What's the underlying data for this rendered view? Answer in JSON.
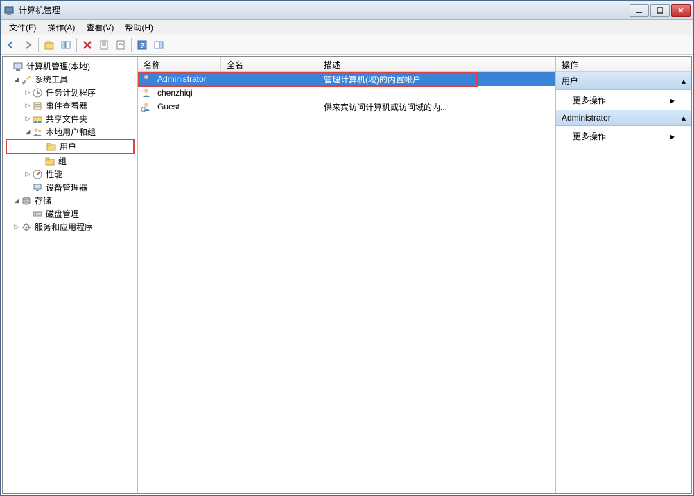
{
  "window": {
    "title": "计算机管理"
  },
  "menu": {
    "file": "文件(F)",
    "action": "操作(A)",
    "view": "查看(V)",
    "help": "帮助(H)"
  },
  "tree": {
    "root": "计算机管理(本地)",
    "systools": "系统工具",
    "task_sched": "任务计划程序",
    "event_viewer": "事件查看器",
    "shared_folders": "共享文件夹",
    "local_users": "本地用户和组",
    "users": "用户",
    "groups": "组",
    "performance": "性能",
    "device_mgr": "设备管理器",
    "storage": "存储",
    "disk_mgmt": "磁盘管理",
    "services": "服务和应用程序"
  },
  "list": {
    "headers": {
      "name": "名称",
      "fullname": "全名",
      "description": "描述"
    },
    "rows": [
      {
        "name": "Administrator",
        "fullname": "",
        "desc": "管理计算机(域)的内置帐户",
        "selected": true,
        "highlight": true
      },
      {
        "name": "chenzhiqi",
        "fullname": "",
        "desc": "",
        "selected": false
      },
      {
        "name": "Guest",
        "fullname": "",
        "desc": "供来宾访问计算机或访问域的内...",
        "selected": false
      }
    ]
  },
  "actions": {
    "title": "操作",
    "group1": "用户",
    "more": "更多操作",
    "group2": "Administrator"
  }
}
